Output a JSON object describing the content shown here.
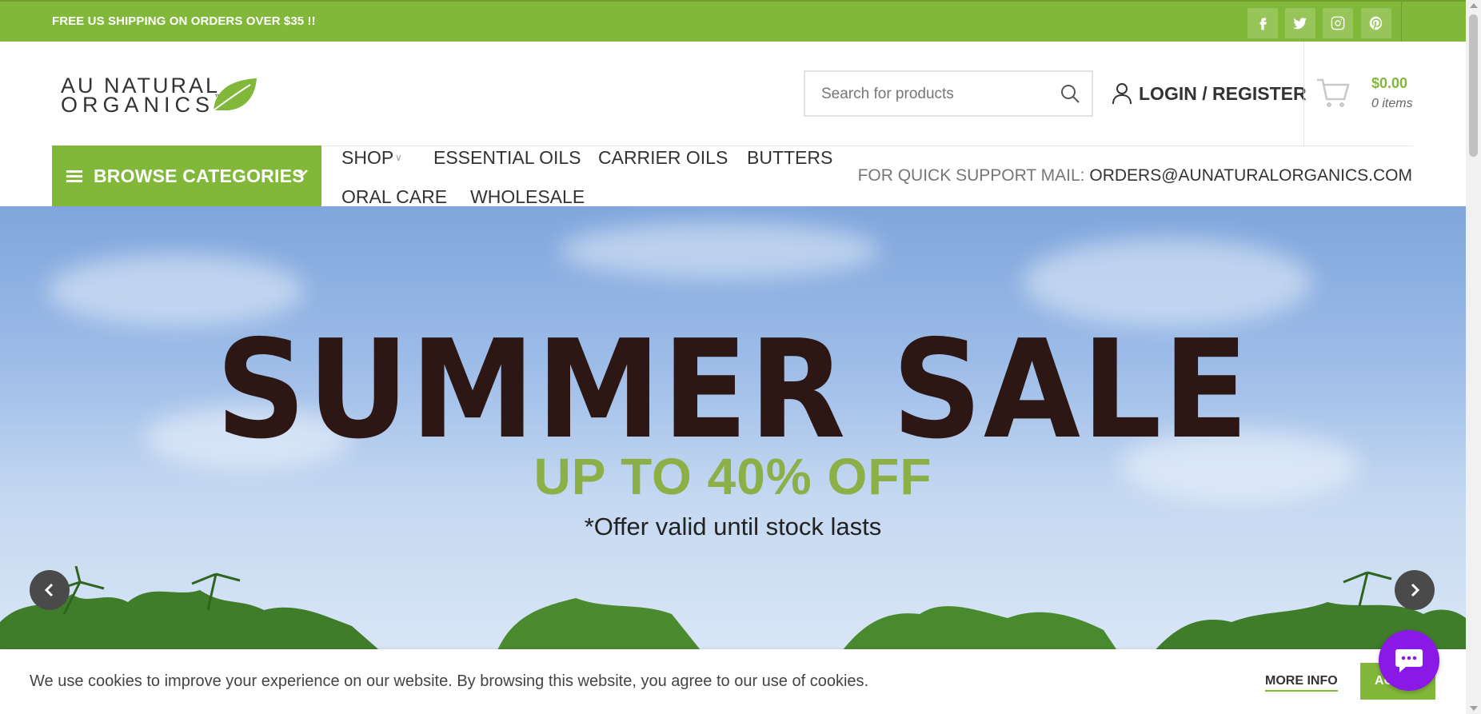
{
  "topbar": {
    "promo": "FREE US SHIPPING ON ORDERS OVER $35 !!",
    "social": [
      "facebook-icon",
      "twitter-icon",
      "instagram-icon",
      "pinterest-icon"
    ],
    "bg_color": "#82b83a"
  },
  "header": {
    "logo_line1": "AU NATURAL",
    "logo_line2": "ORGANICS",
    "logo_tm": "™",
    "search_placeholder": "Search for products",
    "login_label": "LOGIN / REGISTER",
    "cart_total": "$0.00",
    "cart_items": "0 items"
  },
  "nav": {
    "browse_label": "BROWSE CATEGORIES",
    "items": [
      "SHOP",
      "ESSENTIAL OILS",
      "CARRIER OILS",
      "BUTTERS",
      "ORAL CARE",
      "WHOLESALE"
    ],
    "support_label": "FOR QUICK SUPPORT MAIL:",
    "support_email": "ORDERS@AUNATURALORGANICS.COM"
  },
  "hero": {
    "title": "SUMMER SALE",
    "subtitle": "UP TO 40% OFF",
    "note": "*Offer valid until stock lasts",
    "title_color": "#2c1714",
    "subtitle_color": "#8bb048"
  },
  "cookie": {
    "text": "We use cookies to improve your experience on our website. By browsing this website, you agree to our use of cookies.",
    "more_info": "MORE INFO",
    "accept": "ACCEPT"
  },
  "colors": {
    "accent": "#82b83a",
    "chat": "#8a18e6"
  }
}
